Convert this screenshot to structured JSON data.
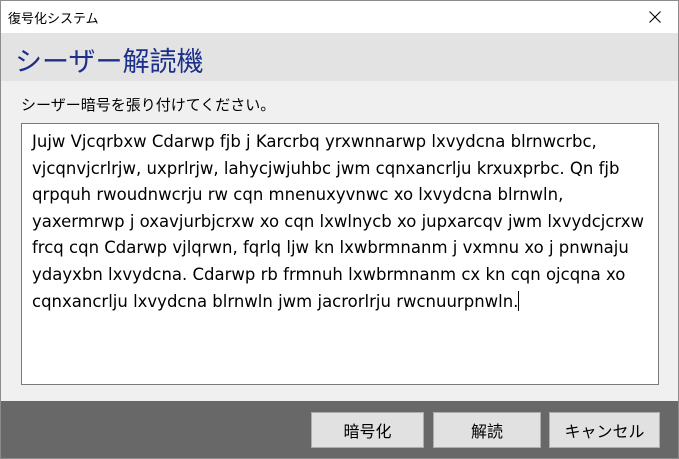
{
  "window": {
    "title": "復号化システム",
    "close_icon": "close-icon"
  },
  "banner": {
    "title": "シーザー解読機"
  },
  "main": {
    "prompt": "シーザー暗号を張り付けてください。",
    "text_value": "Jujw Vjcqrbxw Cdarwp fjb j Karcrbq yrxwnnarwp lxvydcna blrnwcrbc, vjcqnvjcrlrjw, uxprlrjw, lahycjwjuhbc jwm cqnxancrlju krxuxprbc. Qn fjb qrpquh rwoudnwcrju rw cqn mnenuxyvnwc xo lxvydcna blrnwln, yaxermrwp j oxavjurbjcrxw xo cqn lxwlnycb xo jupxarcqv jwm lxvydcjcrxw frcq cqn Cdarwp vjlqrwn, fqrlq ljw kn lxwbrmnanm j vxmnu xo j pnwnaju ydayxbn lxvydcna. Cdarwp rb frmnuh lxwbrmnanm cx kn cqn ojcqna xo cqnxancrlju lxvydcna blrnwln jwm jacrorlrju rwcnuurpnwln."
  },
  "footer": {
    "encrypt_label": "暗号化",
    "decrypt_label": "解読",
    "cancel_label": "キャンセル"
  }
}
